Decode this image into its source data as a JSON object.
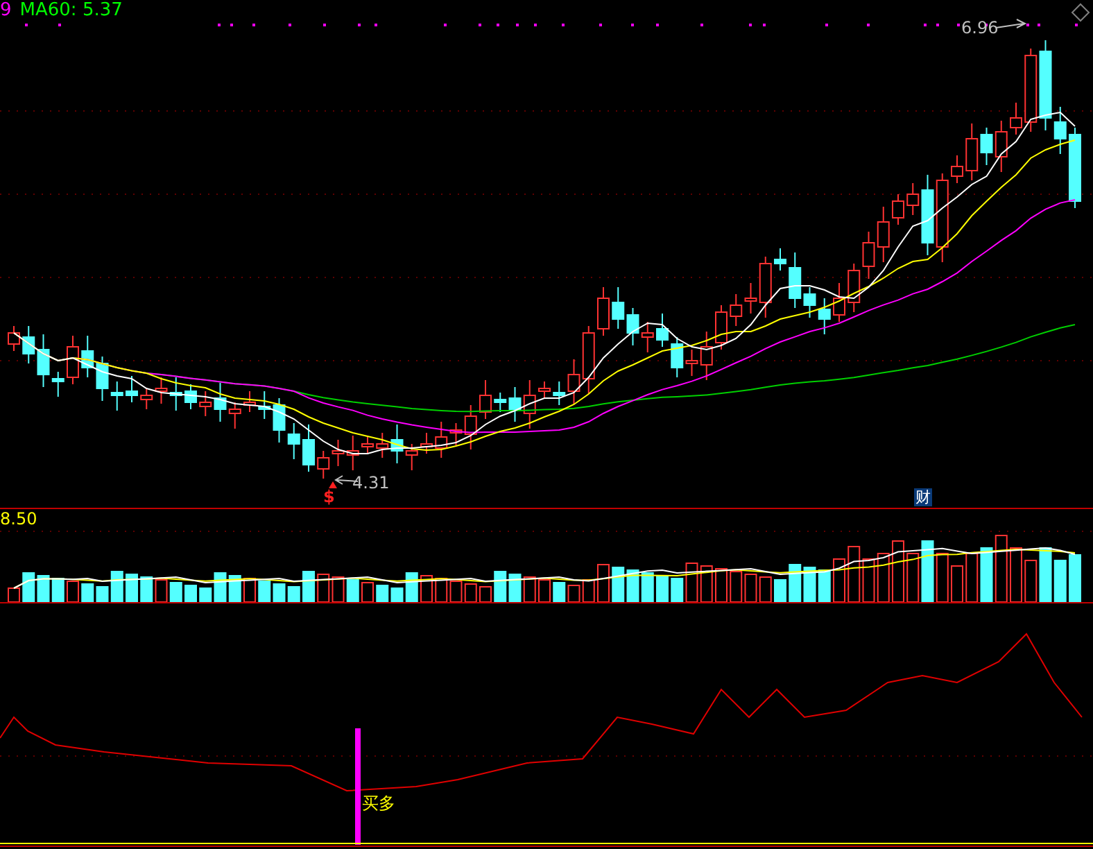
{
  "main_panel": {
    "legend": [
      {
        "text": "9",
        "color": "#ff00ff"
      },
      {
        "text": "MA60: 5.37",
        "color": "#00ff00"
      }
    ],
    "high_label": "6.96",
    "low_label": "4.31",
    "signal_mark": "$",
    "event_badge": "财"
  },
  "volume_panel": {
    "scale_label": "8.50"
  },
  "indicator_panel": {
    "signal_label": "买多"
  }
}
